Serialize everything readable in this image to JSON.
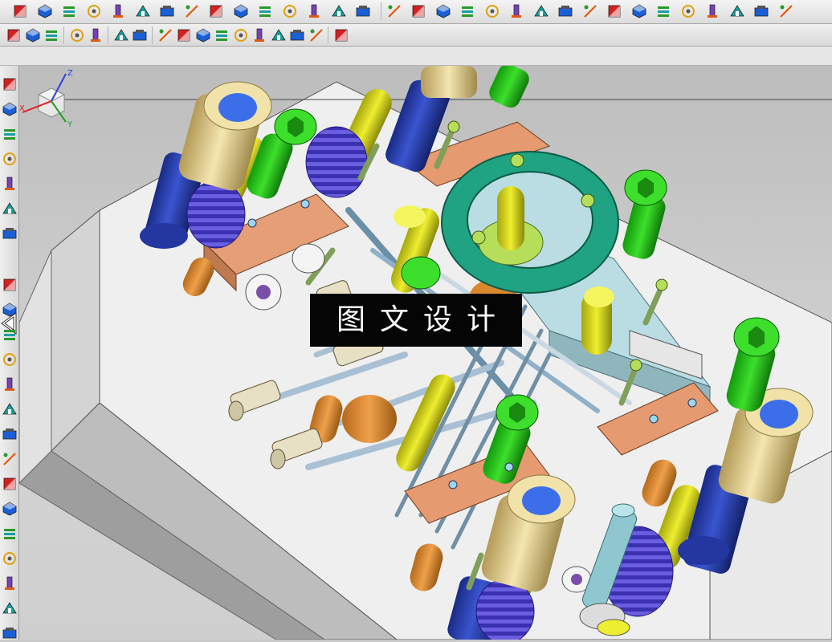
{
  "watermark": {
    "text": "图文设计"
  },
  "triad": {
    "axis_z": "Z",
    "axis_x": "X",
    "axis_y": "Y"
  },
  "colors": {
    "toolbar_bg": "#e3e3e3",
    "viewport_bg": "#c9c9c9",
    "plate": "#f3f3f3",
    "bushing": "#e8d89a",
    "pillar": "#2b3fa8",
    "spring": "#4b3fc4",
    "bolt_green": "#22c416",
    "pin_yellow": "#d8d81a",
    "copper_block": "#e59a70",
    "ring_teal": "#1fa383",
    "light_blue_block": "#b9dde3",
    "orange_pin": "#d9882e"
  },
  "toolbar_top_icons": [
    "command-finder-icon",
    "snap-icon",
    "section-icon",
    "layer-icon",
    "layer-visible-icon",
    "view-section-icon",
    "dimension-icon",
    "ordinate-icon",
    "thread-icon",
    "weld-icon",
    "text-a-icon",
    "hatch-icon",
    "table-icon",
    "list-icon",
    "more-dropdown-icon",
    "part-nav-icon",
    "assembly-icon",
    "constraint-icon",
    "csys-icon",
    "box-icon",
    "mirror-icon",
    "component-icon",
    "tools-icon",
    "mold-icon",
    "layout-icon",
    "electrode-icon",
    "mold-wizard-icon",
    "ejector-icon",
    "cooling-icon",
    "slider-icon",
    "report-icon",
    "rotate-icon"
  ],
  "toolbar_second_icons": [
    "select-filter-icon",
    "select-type-icon",
    "rectangle-select-icon",
    "view-shaded-icon",
    "view-wire-icon",
    "snap-point-icon",
    "snap-end-icon",
    "line-icon",
    "curve-icon",
    "arc-icon",
    "circle-icon",
    "circle-center-icon",
    "point-icon",
    "cross-icon",
    "slash-icon",
    "view-icon",
    "grid-icon"
  ],
  "left_palette_icons": [
    "cube-icon",
    "assembly-tree-icon",
    "roles-icon",
    "history-icon",
    "feature-icon",
    "rotate-view-icon",
    "mold-flow-icon",
    "hot-runner-icon",
    "eject-icon",
    "spring-icon",
    "measure-icon",
    "cooling-line-icon",
    "insert-icon",
    "gate-icon",
    "pocket-icon",
    "electrode-icon",
    "slider-icon",
    "cavity-icon",
    "runner-icon",
    "bom-icon",
    "drawing-icon",
    "align-icon"
  ]
}
